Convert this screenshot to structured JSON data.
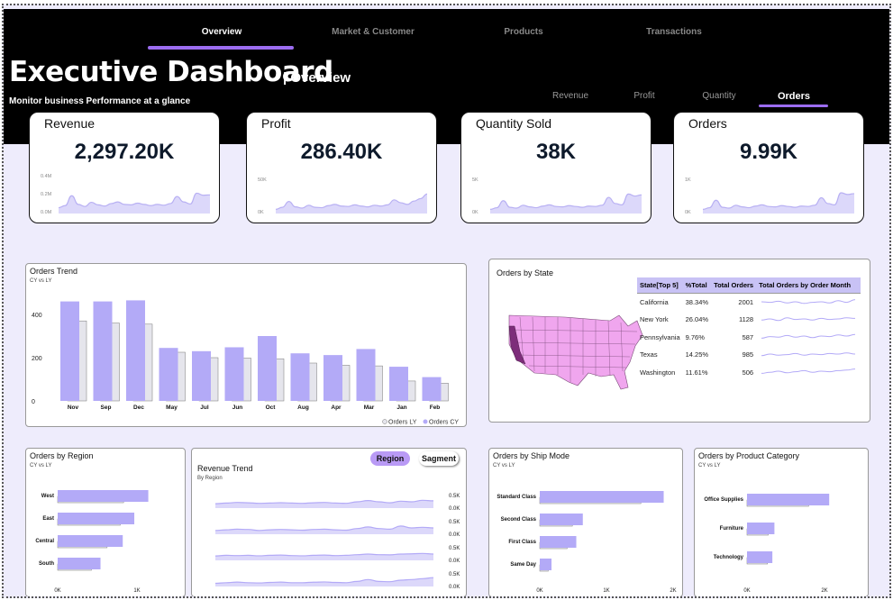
{
  "nav": {
    "tabs": [
      {
        "label": "Overview",
        "active": true
      },
      {
        "label": "Market & Customer",
        "active": false
      },
      {
        "label": "Products",
        "active": false
      },
      {
        "label": "Transactions",
        "active": false
      }
    ]
  },
  "header": {
    "title": "Executive Dashboard",
    "section": "| Overview",
    "tagline": "Monitor business Performance at a glance"
  },
  "metric_tabs": [
    {
      "label": "Revenue",
      "active": false
    },
    {
      "label": "Profit",
      "active": false
    },
    {
      "label": "Quantity",
      "active": false
    },
    {
      "label": "Orders",
      "active": true
    }
  ],
  "kpis": [
    {
      "label": "Revenue",
      "value": "2,297.20K",
      "axis": [
        "0.4M",
        "0.2M",
        "0.0M"
      ],
      "trend": [
        0.14,
        0.19,
        0.43,
        0.22,
        0.17,
        0.27,
        0.21,
        0.18,
        0.24,
        0.28,
        0.22,
        0.21,
        0.25,
        0.22,
        0.19,
        0.22,
        0.2,
        0.24,
        0.41,
        0.28,
        0.23,
        0.49,
        0.44,
        0.45
      ]
    },
    {
      "label": "Profit",
      "value": "286.40K",
      "axis": [
        "50K",
        "0K"
      ],
      "trend": [
        0.1,
        0.15,
        0.29,
        0.16,
        0.13,
        0.2,
        0.15,
        0.14,
        0.19,
        0.22,
        0.18,
        0.17,
        0.21,
        0.18,
        0.16,
        0.2,
        0.18,
        0.21,
        0.33,
        0.26,
        0.22,
        0.3,
        0.36,
        0.47
      ]
    },
    {
      "label": "Quantity Sold",
      "value": "38K",
      "axis": [
        "5K",
        "0K"
      ],
      "trend": [
        0.1,
        0.14,
        0.31,
        0.15,
        0.13,
        0.2,
        0.16,
        0.14,
        0.18,
        0.21,
        0.17,
        0.16,
        0.19,
        0.17,
        0.15,
        0.18,
        0.17,
        0.2,
        0.39,
        0.24,
        0.21,
        0.47,
        0.42,
        0.45
      ]
    },
    {
      "label": "Orders",
      "value": "9.99K",
      "axis": [
        "1K",
        "0K"
      ],
      "trend": [
        0.1,
        0.14,
        0.32,
        0.15,
        0.13,
        0.2,
        0.16,
        0.14,
        0.18,
        0.21,
        0.17,
        0.16,
        0.19,
        0.17,
        0.15,
        0.18,
        0.17,
        0.2,
        0.38,
        0.24,
        0.21,
        0.5,
        0.46,
        0.48
      ]
    }
  ],
  "orders_trend": {
    "title": "Orders Trend",
    "subtitle": "CY vs LY",
    "legend": [
      "Orders LY",
      "Orders CY"
    ]
  },
  "orders_by_state": {
    "title": "Orders by State",
    "columns": [
      "State[Top 5]",
      "%Total",
      "Total Orders",
      "Total Orders by Order  Month"
    ],
    "rows": [
      {
        "state": "California",
        "pct": "38.34%",
        "orders": "2001",
        "spark": [
          0.5,
          0.45,
          0.55,
          0.4,
          0.5,
          0.35,
          0.45,
          0.5,
          0.4,
          0.6,
          0.45,
          0.7
        ]
      },
      {
        "state": "New York",
        "pct": "26.04%",
        "orders": "1128",
        "spark": [
          0.4,
          0.5,
          0.35,
          0.6,
          0.45,
          0.5,
          0.4,
          0.55,
          0.45,
          0.5,
          0.6,
          0.55
        ]
      },
      {
        "state": "Pennsylvania",
        "pct": "9.76%",
        "orders": "587",
        "spark": [
          0.3,
          0.45,
          0.4,
          0.55,
          0.4,
          0.5,
          0.35,
          0.5,
          0.45,
          0.6,
          0.5,
          0.65
        ]
      },
      {
        "state": "Texas",
        "pct": "14.25%",
        "orders": "985",
        "spark": [
          0.35,
          0.5,
          0.4,
          0.45,
          0.55,
          0.4,
          0.5,
          0.45,
          0.55,
          0.5,
          0.6,
          0.5
        ]
      },
      {
        "state": "Washington",
        "pct": "11.61%",
        "orders": "506",
        "spark": [
          0.3,
          0.4,
          0.5,
          0.35,
          0.45,
          0.55,
          0.4,
          0.5,
          0.45,
          0.55,
          0.6,
          0.7
        ]
      }
    ]
  },
  "orders_by_region": {
    "title": "Orders by Region",
    "subtitle": "CY vs LY"
  },
  "revenue_trend": {
    "title": "Revenue Trend",
    "subtitle": "By Region",
    "toggle_on": "Region",
    "toggle_off": "Sagment",
    "axis": [
      "0.5K",
      "0.0K",
      "0.5K",
      "0.0K",
      "0.5K",
      "0.0K",
      "0.5K",
      "0.0K"
    ],
    "lines": [
      [
        0.35,
        0.4,
        0.45,
        0.42,
        0.38,
        0.4,
        0.43,
        0.4,
        0.38,
        0.42,
        0.45,
        0.4,
        0.38,
        0.5,
        0.6,
        0.5,
        0.42,
        0.55,
        0.5,
        0.62,
        0.58
      ],
      [
        0.3,
        0.35,
        0.4,
        0.38,
        0.3,
        0.35,
        0.38,
        0.35,
        0.32,
        0.38,
        0.4,
        0.35,
        0.32,
        0.45,
        0.58,
        0.45,
        0.4,
        0.65,
        0.5,
        0.55,
        0.5
      ],
      [
        0.35,
        0.4,
        0.38,
        0.4,
        0.36,
        0.4,
        0.42,
        0.38,
        0.36,
        0.4,
        0.42,
        0.38,
        0.4,
        0.45,
        0.5,
        0.45,
        0.44,
        0.5,
        0.52,
        0.55,
        0.5
      ],
      [
        0.25,
        0.3,
        0.35,
        0.3,
        0.28,
        0.32,
        0.35,
        0.3,
        0.3,
        0.34,
        0.36,
        0.32,
        0.3,
        0.4,
        0.55,
        0.4,
        0.38,
        0.5,
        0.55,
        0.62,
        0.7
      ]
    ]
  },
  "orders_by_ship_mode": {
    "title": "Orders by Ship Mode",
    "subtitle": "CY vs LY"
  },
  "orders_by_category": {
    "title": "Orders by Product Category",
    "subtitle": "CY vs LY"
  },
  "colors": {
    "cy": "#b3aaf7",
    "ly": "#e5e5ec",
    "accent": "#9b6cf0",
    "map_base": "#f0a6ee",
    "map_high": "#7d2d7a"
  },
  "chart_data": [
    {
      "type": "bar",
      "name": "Orders Trend",
      "categories": [
        "Nov",
        "Sep",
        "Dec",
        "May",
        "Jul",
        "Jun",
        "Oct",
        "Aug",
        "Apr",
        "Mar",
        "Jan",
        "Feb"
      ],
      "series": [
        {
          "name": "Orders CY",
          "values": [
            460,
            460,
            465,
            245,
            230,
            248,
            300,
            220,
            212,
            240,
            158,
            110
          ]
        },
        {
          "name": "Orders LY",
          "values": [
            370,
            360,
            355,
            225,
            200,
            198,
            195,
            175,
            165,
            162,
            92,
            82
          ]
        }
      ],
      "yticks": [
        0,
        200,
        400
      ],
      "ylim": [
        0,
        500
      ],
      "legend": "bottom-right"
    },
    {
      "type": "bar",
      "name": "Orders by Region",
      "orientation": "horizontal",
      "categories": [
        "West",
        "East",
        "Central",
        "South"
      ],
      "series": [
        {
          "name": "CY",
          "values": [
            1100,
            930,
            790,
            520
          ]
        },
        {
          "name": "LY",
          "values": [
            800,
            760,
            600,
            410
          ]
        }
      ],
      "xticks": [
        "0K",
        "1K"
      ],
      "xlim": [
        0,
        1400
      ]
    },
    {
      "type": "bar",
      "name": "Orders by Ship Mode",
      "orientation": "horizontal",
      "categories": [
        "Standard Class",
        "Second Class",
        "First Class",
        "Same Day"
      ],
      "series": [
        {
          "name": "CY",
          "values": [
            1900,
            660,
            560,
            180
          ]
        },
        {
          "name": "LY",
          "values": [
            1550,
            500,
            420,
            130
          ]
        }
      ],
      "xticks": [
        "0K",
        "1K",
        "2K"
      ],
      "xlim": [
        0,
        2100
      ]
    },
    {
      "type": "bar",
      "name": "Orders by Product Category",
      "orientation": "horizontal",
      "categories": [
        "Office Supplies",
        "Furniture",
        "Technology"
      ],
      "series": [
        {
          "name": "CY",
          "values": [
            2400,
            800,
            740
          ]
        },
        {
          "name": "LY",
          "values": [
            1800,
            620,
            600
          ]
        }
      ],
      "xticks": [
        "0K",
        "2K"
      ],
      "xlim": [
        0,
        3000
      ]
    }
  ]
}
